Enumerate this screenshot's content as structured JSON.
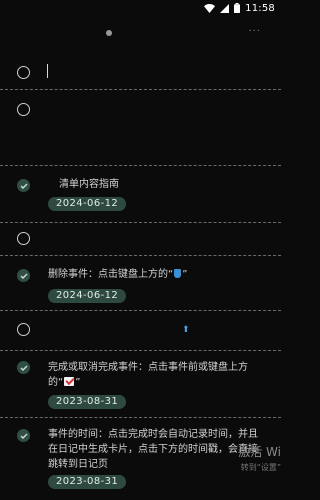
{
  "status_bar": {
    "time": "11:58",
    "icons": [
      "wifi-icon",
      "signal-icon",
      "battery-icon"
    ]
  },
  "header": {
    "more_label": "···"
  },
  "items": [
    {
      "checked": false,
      "text": "",
      "date": ""
    },
    {
      "checked": false,
      "text": "",
      "date": ""
    },
    {
      "checked": true,
      "text": "清单内容指南",
      "date": "2024-06-12"
    },
    {
      "checked": false,
      "text": "",
      "date": ""
    },
    {
      "checked": true,
      "text_before": "删除事件：点击键盘上方的“",
      "text_after": "”",
      "date": "2024-06-12"
    },
    {
      "checked": false,
      "text": "",
      "date": ""
    },
    {
      "checked": true,
      "text_line1": "完成或取消完成事件：点击事件前或键盘上方",
      "text_line2_before": "的“",
      "text_line2_after": "”",
      "date": "2023-08-31"
    },
    {
      "checked": true,
      "text_line1": "事件的时间：点击完成时会自动记录时间，并且",
      "text_line2": "在日记中生成卡片，点击下方的时间戳，会直接",
      "text_line3": "跳转到日记页",
      "date": "2023-08-31"
    }
  ],
  "watermark": {
    "main": "激活 Wi",
    "sub": "转到“设置”"
  },
  "colors": {
    "background": "#0b0b0b",
    "accent_green": "#2e4a40",
    "check_color": "#cfe1d8"
  }
}
